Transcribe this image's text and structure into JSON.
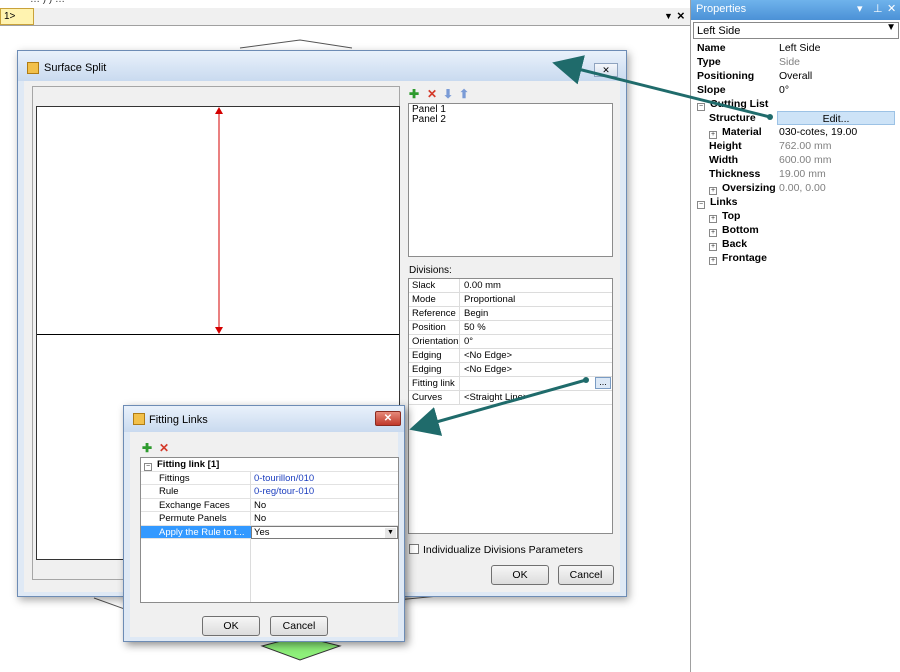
{
  "top_strip": {
    "text": "… ) ) …"
  },
  "doc_tab": {
    "label": "1>"
  },
  "properties": {
    "title": "Properties",
    "title_controls": [
      "▾",
      "⊥",
      "✕"
    ],
    "object_combo": "Left Side",
    "rows": [
      {
        "key": "Name",
        "value": "Left Side",
        "gray": false,
        "indent": 0,
        "exp": ""
      },
      {
        "key": "Type",
        "value": "Side",
        "gray": true,
        "indent": 0,
        "exp": ""
      },
      {
        "key": "Positioning",
        "value": "Overall",
        "gray": false,
        "indent": 0,
        "exp": ""
      },
      {
        "key": "Slope",
        "value": "0°",
        "gray": false,
        "indent": 0,
        "exp": ""
      },
      {
        "key": "Cutting List",
        "value": "",
        "gray": false,
        "indent": 0,
        "exp": "−"
      },
      {
        "key": "Structure",
        "value": "Edit...",
        "gray": false,
        "indent": 1,
        "exp": ""
      },
      {
        "key": "Material",
        "value": "030-cotes, 19.00",
        "gray": false,
        "indent": 1,
        "exp": "+"
      },
      {
        "key": "Height",
        "value": "762.00 mm",
        "gray": true,
        "indent": 1,
        "exp": ""
      },
      {
        "key": "Width",
        "value": "600.00 mm",
        "gray": true,
        "indent": 1,
        "exp": ""
      },
      {
        "key": "Thickness",
        "value": "19.00 mm",
        "gray": true,
        "indent": 1,
        "exp": ""
      },
      {
        "key": "Oversizing",
        "value": "0.00, 0.00",
        "gray": true,
        "indent": 1,
        "exp": "+"
      },
      {
        "key": "Links",
        "value": "",
        "gray": false,
        "indent": 0,
        "exp": "−"
      },
      {
        "key": "Top",
        "value": "",
        "gray": false,
        "indent": 1,
        "exp": "+"
      },
      {
        "key": "Bottom",
        "value": "",
        "gray": false,
        "indent": 1,
        "exp": "+"
      },
      {
        "key": "Back",
        "value": "",
        "gray": false,
        "indent": 1,
        "exp": "+"
      },
      {
        "key": "Frontage",
        "value": "",
        "gray": false,
        "indent": 1,
        "exp": "+"
      }
    ]
  },
  "surface_split": {
    "title": "Surface Split",
    "close_glyph": "✕",
    "toolbar": {
      "add": "✚",
      "delete": "✕",
      "down": "⬇",
      "up": "⬆"
    },
    "panels": [
      "Panel 1",
      "Panel 2"
    ],
    "divisions_label": "Divisions:",
    "divisions": [
      {
        "key": "Slack",
        "value": "0.00 mm"
      },
      {
        "key": "Mode",
        "value": "Proportional"
      },
      {
        "key": "Reference",
        "value": "Begin"
      },
      {
        "key": "Position",
        "value": "50 %"
      },
      {
        "key": "Orientation",
        "value": "0°"
      },
      {
        "key": "Edging",
        "value": "<No Edge>"
      },
      {
        "key": "Edging",
        "value": "<No Edge>"
      },
      {
        "key": "Fitting link",
        "value": ""
      },
      {
        "key": "Curves",
        "value": "<Straight Line>"
      }
    ],
    "dots_label": "...",
    "individualize_label": "Individualize Divisions Parameters",
    "ok": "OK",
    "cancel": "Cancel"
  },
  "fitting_links": {
    "title": "Fitting Links",
    "close_glyph": "✕",
    "toolbar": {
      "add": "✚",
      "delete": "✕"
    },
    "group": "Fitting link [1]",
    "rows": [
      {
        "key": "Fittings",
        "value": "0-tourillon/010",
        "blue": true
      },
      {
        "key": "Rule",
        "value": "0-reg/tour-010",
        "blue": true
      },
      {
        "key": "Exchange Faces",
        "value": "No",
        "blue": false
      },
      {
        "key": "Permute Panels",
        "value": "No",
        "blue": false
      }
    ],
    "selected_row": {
      "key": "Apply the Rule to t...",
      "value": "Yes"
    },
    "ok": "OK",
    "cancel": "Cancel"
  },
  "colors": {
    "accent_arrow": "#1f6b6b",
    "selection": "#3399ff",
    "title_blue": "#4b91d6"
  }
}
